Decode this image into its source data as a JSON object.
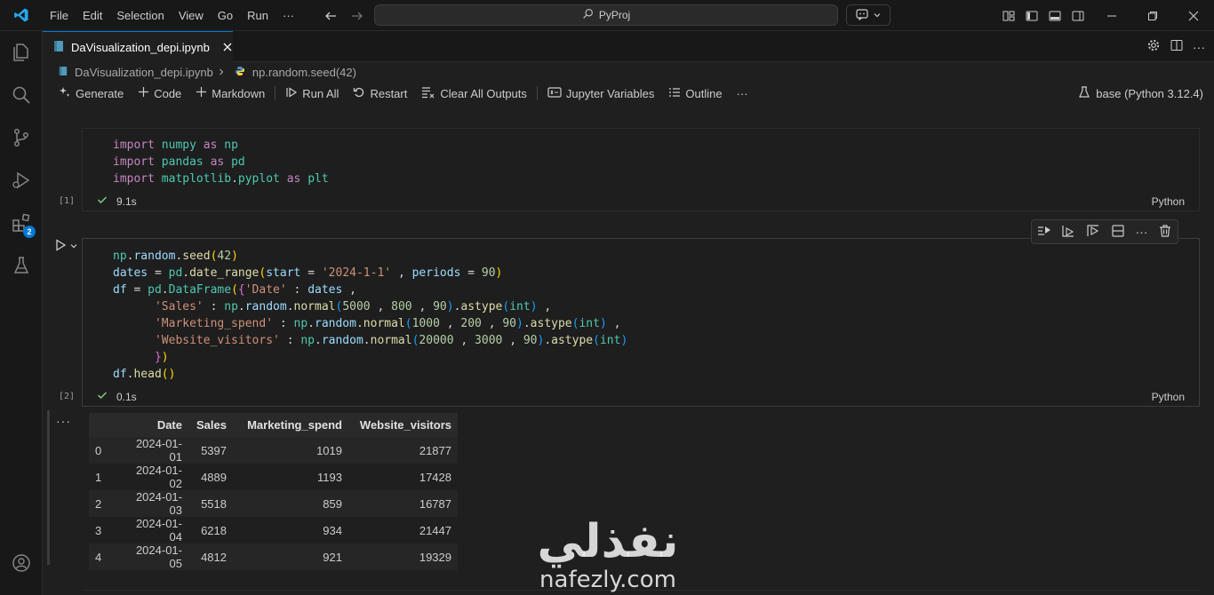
{
  "titlebar": {
    "menu": [
      "File",
      "Edit",
      "Selection",
      "View",
      "Go",
      "Run",
      "···"
    ],
    "search_text": "PyProj"
  },
  "activity": {
    "extensions_badge": "2"
  },
  "tab": {
    "filename": "DaVisualization_depi.ipynb"
  },
  "breadcrumb": {
    "file": "DaVisualization_depi.ipynb",
    "symbol": "np.random.seed(42)"
  },
  "toolbar": {
    "generate": "Generate",
    "code": "Code",
    "markdown": "Markdown",
    "run_all": "Run All",
    "restart": "Restart",
    "clear_outputs": "Clear All Outputs",
    "variables": "Jupyter Variables",
    "outline": "Outline",
    "more": "···",
    "kernel": "base (Python 3.12.4)"
  },
  "cells": [
    {
      "exec_count": "[1]",
      "time": "9.1s",
      "language": "Python"
    },
    {
      "exec_count": "[2]",
      "time": "0.1s",
      "language": "Python"
    }
  ],
  "output": {
    "more": "···",
    "columns": [
      "",
      "Date",
      "Sales",
      "Marketing_spend",
      "Website_visitors"
    ],
    "rows": [
      [
        "0",
        "2024-01-01",
        "5397",
        "1019",
        "21877"
      ],
      [
        "1",
        "2024-01-02",
        "4889",
        "1193",
        "17428"
      ],
      [
        "2",
        "2024-01-03",
        "5518",
        "859",
        "16787"
      ],
      [
        "3",
        "2024-01-04",
        "6218",
        "934",
        "21447"
      ],
      [
        "4",
        "2024-01-05",
        "4812",
        "921",
        "19329"
      ]
    ]
  },
  "watermark": {
    "arabic": "نفذلي",
    "latin": "nafezly.com"
  },
  "colors": {
    "accent": "#0078d4",
    "keyword": "#c586c0",
    "string": "#ce9178",
    "number": "#b5cea8",
    "function": "#dcdcaa"
  }
}
